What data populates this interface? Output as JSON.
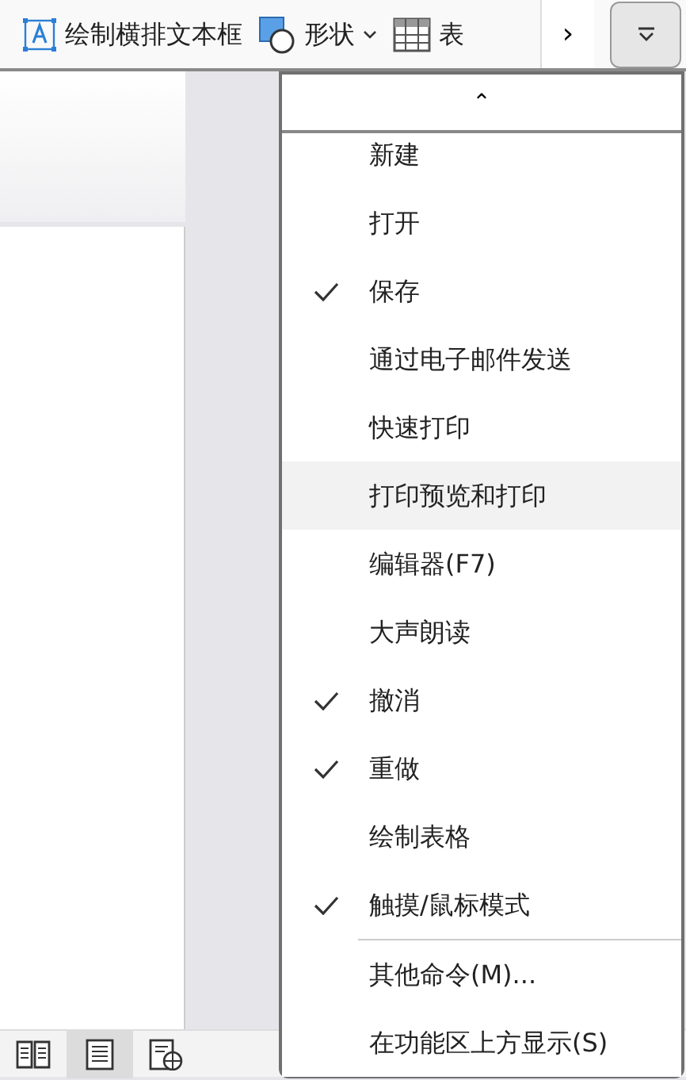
{
  "toolbar": {
    "items": [
      {
        "kind": "textbox",
        "label": "绘制横排文本框"
      },
      {
        "kind": "shapes",
        "label": "形状",
        "dropdown": true
      },
      {
        "kind": "table",
        "label": "表"
      }
    ],
    "more": "›"
  },
  "status_bar": {
    "views": [
      {
        "kind": "read",
        "selected": false
      },
      {
        "kind": "page",
        "selected": true
      },
      {
        "kind": "web",
        "selected": false
      }
    ]
  },
  "menu": {
    "scroll_up": "⌃",
    "items": [
      {
        "kind": "command",
        "label": "新建",
        "checked": false,
        "highlighted": false
      },
      {
        "kind": "command",
        "label": "打开",
        "checked": false,
        "highlighted": false
      },
      {
        "kind": "command",
        "label": "保存",
        "checked": true,
        "highlighted": false
      },
      {
        "kind": "command",
        "label": "通过电子邮件发送",
        "checked": false,
        "highlighted": false
      },
      {
        "kind": "command",
        "label": "快速打印",
        "checked": false,
        "highlighted": false
      },
      {
        "kind": "command",
        "label": "打印预览和打印",
        "checked": false,
        "highlighted": true
      },
      {
        "kind": "command",
        "label": "编辑器(F7)",
        "checked": false,
        "highlighted": false
      },
      {
        "kind": "command",
        "label": "大声朗读",
        "checked": false,
        "highlighted": false
      },
      {
        "kind": "command",
        "label": "撤消",
        "checked": true,
        "highlighted": false
      },
      {
        "kind": "command",
        "label": "重做",
        "checked": true,
        "highlighted": false
      },
      {
        "kind": "command",
        "label": "绘制表格",
        "checked": false,
        "highlighted": false
      },
      {
        "kind": "command",
        "label": "触摸/鼠标模式",
        "checked": true,
        "highlighted": false
      },
      {
        "kind": "separator"
      },
      {
        "kind": "command",
        "label": "其他命令(M)...",
        "checked": false,
        "highlighted": false
      },
      {
        "kind": "command",
        "label": "在功能区上方显示(S)",
        "checked": false,
        "highlighted": false
      }
    ]
  }
}
